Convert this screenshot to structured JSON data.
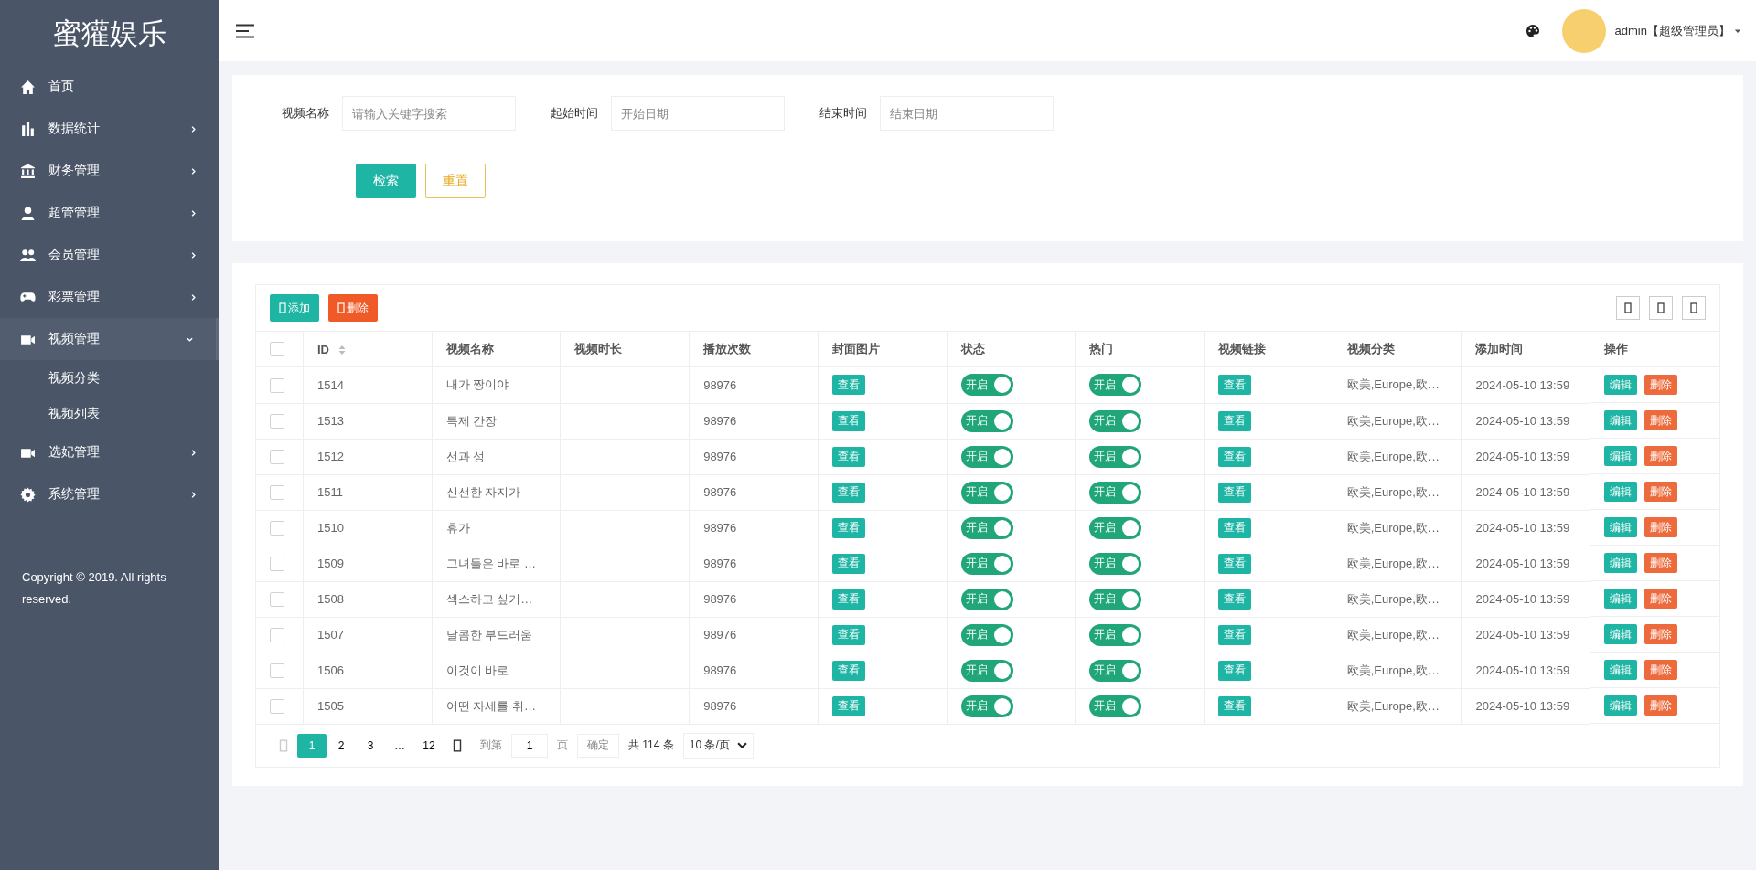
{
  "sidebar": {
    "logo": "蜜獾娱乐",
    "items": [
      {
        "label": "首页",
        "kind": "link",
        "selected": false
      },
      {
        "label": "数据统计",
        "kind": "menu",
        "selected": false,
        "expanded": false
      },
      {
        "label": "财务管理",
        "kind": "menu",
        "selected": false,
        "expanded": false
      },
      {
        "label": "超管管理",
        "kind": "menu",
        "selected": false,
        "expanded": false
      },
      {
        "label": "会员管理",
        "kind": "menu",
        "selected": false,
        "expanded": false
      },
      {
        "label": "彩票管理",
        "kind": "menu",
        "selected": false,
        "expanded": false
      },
      {
        "label": "视频管理",
        "kind": "menu",
        "selected": true,
        "expanded": true,
        "children": [
          {
            "label": "视频分类",
            "selected": false
          },
          {
            "label": "视频列表",
            "selected": false
          }
        ]
      },
      {
        "label": "选妃管理",
        "kind": "menu",
        "selected": false,
        "expanded": false
      },
      {
        "label": "系统管理",
        "kind": "menu",
        "selected": false,
        "expanded": false
      }
    ],
    "copyright": "Copyright © 2019. All rights reserved."
  },
  "header": {
    "user": "admin【超级管理员】"
  },
  "search": {
    "fields": [
      {
        "label": "视频名称",
        "placeholder": "请输入关键字搜索"
      },
      {
        "label": "起始时间",
        "placeholder": "开始日期"
      },
      {
        "label": "结束时间",
        "placeholder": "结束日期"
      }
    ],
    "buttons": [
      {
        "label": "检索",
        "kind": "primary"
      },
      {
        "label": "重置",
        "kind": "outline"
      }
    ]
  },
  "toolbar": {
    "buttons": [
      {
        "label": "添加",
        "kind": "primary"
      },
      {
        "label": "删除",
        "kind": "danger"
      }
    ]
  },
  "table": {
    "all_checked": false,
    "columns": [
      "ID",
      "视频名称",
      "视频时长",
      "播放次数",
      "封面图片",
      "状态",
      "热门",
      "视频链接",
      "视频分类",
      "添加时间",
      "操作"
    ],
    "rows": [
      {
        "id": "1514",
        "name": "내가 짱이야",
        "plays": "98976",
        "cover": "查看",
        "status": {
          "label": "开启",
          "on": true
        },
        "hot": {
          "label": "开启",
          "on": true
        },
        "link": "查看",
        "category": "欧美,Europe,欧…",
        "time": "2024-05-10 13:59",
        "actions": [
          "编辑",
          "删除"
        ],
        "checked": false
      },
      {
        "id": "1513",
        "name": "특제 간장",
        "plays": "98976",
        "cover": "查看",
        "status": {
          "label": "开启",
          "on": true
        },
        "hot": {
          "label": "开启",
          "on": true
        },
        "link": "查看",
        "category": "欧美,Europe,欧…",
        "time": "2024-05-10 13:59",
        "actions": [
          "编辑",
          "删除"
        ],
        "checked": false
      },
      {
        "id": "1512",
        "name": "선과 성",
        "plays": "98976",
        "cover": "查看",
        "status": {
          "label": "开启",
          "on": true
        },
        "hot": {
          "label": "开启",
          "on": true
        },
        "link": "查看",
        "category": "欧美,Europe,欧…",
        "time": "2024-05-10 13:59",
        "actions": [
          "编辑",
          "删除"
        ],
        "checked": false
      },
      {
        "id": "1511",
        "name": "신선한 자지가",
        "plays": "98976",
        "cover": "查看",
        "status": {
          "label": "开启",
          "on": true
        },
        "hot": {
          "label": "开启",
          "on": true
        },
        "link": "查看",
        "category": "欧美,Europe,欧…",
        "time": "2024-05-10 13:59",
        "actions": [
          "编辑",
          "删除"
        ],
        "checked": false
      },
      {
        "id": "1510",
        "name": "휴가",
        "plays": "98976",
        "cover": "查看",
        "status": {
          "label": "开启",
          "on": true
        },
        "hot": {
          "label": "开启",
          "on": true
        },
        "link": "查看",
        "category": "欧美,Europe,欧…",
        "time": "2024-05-10 13:59",
        "actions": [
          "编辑",
          "删除"
        ],
        "checked": false
      },
      {
        "id": "1509",
        "name": "그녀들은 바로 …",
        "plays": "98976",
        "cover": "查看",
        "status": {
          "label": "开启",
          "on": true
        },
        "hot": {
          "label": "开启",
          "on": true
        },
        "link": "查看",
        "category": "欧美,Europe,欧…",
        "time": "2024-05-10 13:59",
        "actions": [
          "编辑",
          "删除"
        ],
        "checked": false
      },
      {
        "id": "1508",
        "name": "섹스하고 싶거…",
        "plays": "98976",
        "cover": "查看",
        "status": {
          "label": "开启",
          "on": true
        },
        "hot": {
          "label": "开启",
          "on": true
        },
        "link": "查看",
        "category": "欧美,Europe,欧…",
        "time": "2024-05-10 13:59",
        "actions": [
          "编辑",
          "删除"
        ],
        "checked": false
      },
      {
        "id": "1507",
        "name": "달콤한 부드러움",
        "plays": "98976",
        "cover": "查看",
        "status": {
          "label": "开启",
          "on": true
        },
        "hot": {
          "label": "开启",
          "on": true
        },
        "link": "查看",
        "category": "欧美,Europe,欧…",
        "time": "2024-05-10 13:59",
        "actions": [
          "编辑",
          "删除"
        ],
        "checked": false
      },
      {
        "id": "1506",
        "name": "이것이 바로",
        "plays": "98976",
        "cover": "查看",
        "status": {
          "label": "开启",
          "on": true
        },
        "hot": {
          "label": "开启",
          "on": true
        },
        "link": "查看",
        "category": "欧美,Europe,欧…",
        "time": "2024-05-10 13:59",
        "actions": [
          "编辑",
          "删除"
        ],
        "checked": false
      },
      {
        "id": "1505",
        "name": "어떤 자세를 취…",
        "plays": "98976",
        "cover": "查看",
        "status": {
          "label": "开启",
          "on": true
        },
        "hot": {
          "label": "开启",
          "on": true
        },
        "link": "查看",
        "category": "欧美,Europe,欧…",
        "time": "2024-05-10 13:59",
        "actions": [
          "编辑",
          "删除"
        ],
        "checked": false
      }
    ]
  },
  "pagination": {
    "pages": [
      {
        "label": "1",
        "selected": true
      },
      {
        "label": "2",
        "selected": false
      },
      {
        "label": "3",
        "selected": false
      },
      {
        "label": "…",
        "selected": false
      },
      {
        "label": "12",
        "selected": false
      }
    ],
    "goto_label": "到第",
    "goto_value": "1",
    "page_unit": "页",
    "confirm": "确定",
    "total": "共 114 条",
    "page_size": "10 条/页"
  }
}
